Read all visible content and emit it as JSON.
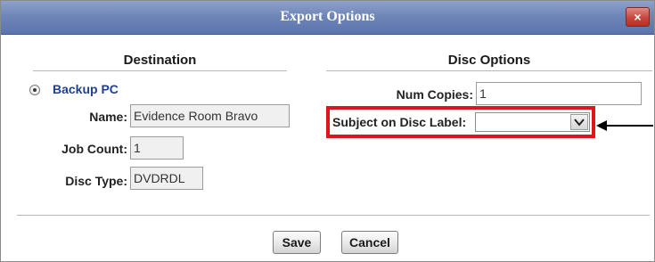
{
  "dialog": {
    "title": "Export Options",
    "close_symbol": "×"
  },
  "destination": {
    "header": "Destination",
    "option_label": "Backup PC",
    "option_selected": true,
    "name_label": "Name:",
    "name_value": "Evidence Room Bravo",
    "job_count_label": "Job Count:",
    "job_count_value": "1",
    "disc_type_label": "Disc Type:",
    "disc_type_value": "DVDRDL"
  },
  "disc_options": {
    "header": "Disc Options",
    "num_copies_label": "Num Copies:",
    "num_copies_value": "1",
    "subject_label": "Subject on Disc Label:",
    "subject_value": ""
  },
  "buttons": {
    "save": "Save",
    "cancel": "Cancel"
  },
  "colors": {
    "titlebar": "#6f86b8",
    "highlight_box": "#e0141c",
    "link_blue": "#1f3f8f"
  },
  "icons": {
    "close": "close-icon",
    "dropdown": "chevron-down-icon",
    "pointer": "arrow-left-icon"
  }
}
